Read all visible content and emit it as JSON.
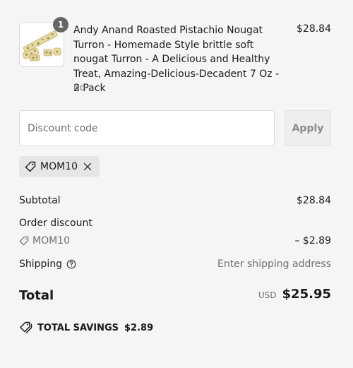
{
  "colors": {
    "background": "#f5f5f5",
    "text": "#1a1a1a",
    "muted": "#707070",
    "badge": "#666666",
    "tag_bg": "#e6e6e6"
  },
  "line_item": {
    "quantity": "1",
    "title": "Andy Anand Roasted Pistachio Nougat Turron - Homemade Style brittle soft nougat Turron - A Delicious and Healthy Treat, Amazing-Delicious-Decadent 7 Oz - 2 Pack",
    "variant": "No",
    "price": "$28.84",
    "thumbnail_icon": "nougat-product-image"
  },
  "discount": {
    "placeholder": "Discount code",
    "value": "",
    "apply_label": "Apply"
  },
  "applied_tag": {
    "code": "MOM10",
    "tag_icon": "tag-icon",
    "remove_icon": "close-icon"
  },
  "summary": {
    "subtotal_label": "Subtotal",
    "subtotal_value": "$28.84",
    "order_discount_label": "Order discount",
    "discount_code": "MOM10",
    "discount_value": "– $2.89",
    "shipping_label": "Shipping",
    "shipping_value": "Enter shipping address",
    "shipping_help_icon": "help-circle-icon"
  },
  "total": {
    "label": "Total",
    "currency": "USD",
    "amount": "$25.95"
  },
  "savings": {
    "label": "TOTAL SAVINGS",
    "amount": "$2.89",
    "icon": "double-tag-icon"
  }
}
